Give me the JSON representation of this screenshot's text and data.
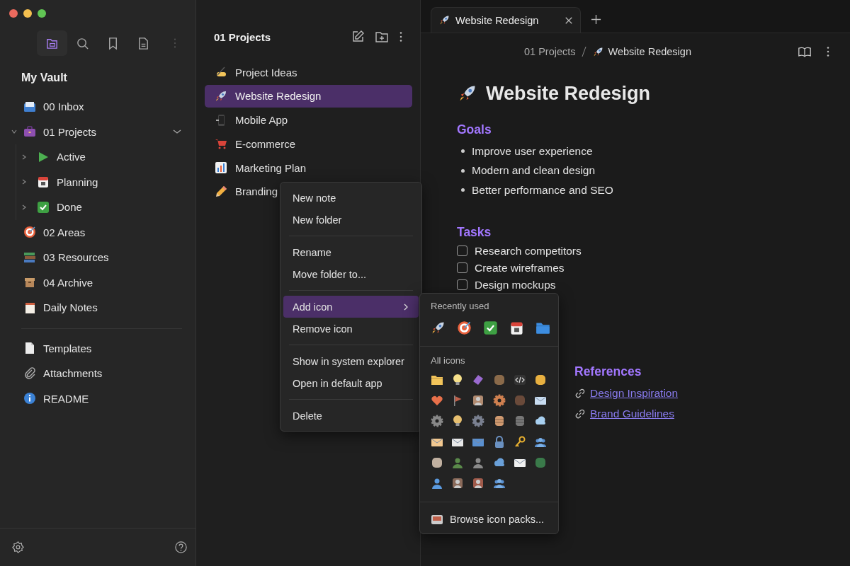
{
  "sidebar": {
    "toolbar": [
      {
        "selected": true
      },
      {
        "selected": false
      },
      {
        "selected": false
      },
      {
        "selected": false
      }
    ],
    "vault_title": "My Vault",
    "folders": [
      {
        "label": "00 Inbox"
      },
      {
        "label": "01 Projects",
        "expanded": true,
        "children": [
          {
            "label": "Active",
            "expanded": false
          },
          {
            "label": "Planning",
            "expanded": false
          },
          {
            "label": "Done",
            "expanded": false
          }
        ]
      },
      {
        "label": "02 Areas"
      },
      {
        "label": "03 Resources"
      },
      {
        "label": "04 Archive"
      },
      {
        "label": "Daily Notes"
      }
    ],
    "pinned": [
      {
        "label": "Templates"
      },
      {
        "label": "Attachments"
      },
      {
        "label": "README"
      }
    ]
  },
  "file_pane": {
    "title": "01 Projects",
    "files": [
      {
        "label": "Project Ideas",
        "selected": false
      },
      {
        "label": "Website Redesign",
        "selected": true
      },
      {
        "label": "Mobile App",
        "selected": false
      },
      {
        "label": "E-commerce",
        "selected": false
      },
      {
        "label": "Marketing Plan",
        "selected": false
      },
      {
        "label": "Branding",
        "selected": false
      }
    ]
  },
  "context_menu": {
    "groups": [
      [
        {
          "label": "New note",
          "selected": false,
          "submenu": false
        },
        {
          "label": "New folder",
          "selected": false,
          "submenu": false
        }
      ],
      [
        {
          "label": "Rename",
          "selected": false,
          "submenu": false
        },
        {
          "label": "Move folder to...",
          "selected": false,
          "submenu": false
        }
      ],
      [
        {
          "label": "Add icon",
          "selected": true,
          "submenu": true
        },
        {
          "label": "Remove icon",
          "selected": false,
          "submenu": false
        }
      ],
      [
        {
          "label": "Show in system explorer",
          "selected": false,
          "submenu": false
        },
        {
          "label": "Open in default app",
          "selected": false,
          "submenu": false
        }
      ],
      [
        {
          "label": "Delete",
          "selected": false,
          "submenu": false
        }
      ]
    ]
  },
  "icon_picker": {
    "recent_title": "Recently used",
    "all_title": "All icons",
    "browse": "Browse icon packs..."
  },
  "tab": {
    "title": "Website Redesign",
    "selected": true
  },
  "breadcrumb": [
    "01 Projects",
    "Website Redesign"
  ],
  "note": {
    "title": "Website Redesign",
    "goals_heading": "Goals",
    "goals": [
      "Improve user experience",
      "Modern and clean design",
      "Better performance and SEO"
    ],
    "tasks_heading": "Tasks",
    "tasks": [
      {
        "label": "Research competitors",
        "checked": false
      },
      {
        "label": "Create wireframes",
        "checked": false
      },
      {
        "label": "Design mockups",
        "checked": false
      }
    ],
    "references_heading": "References",
    "references": [
      "Design Inspiration",
      "Brand Guidelines"
    ]
  }
}
